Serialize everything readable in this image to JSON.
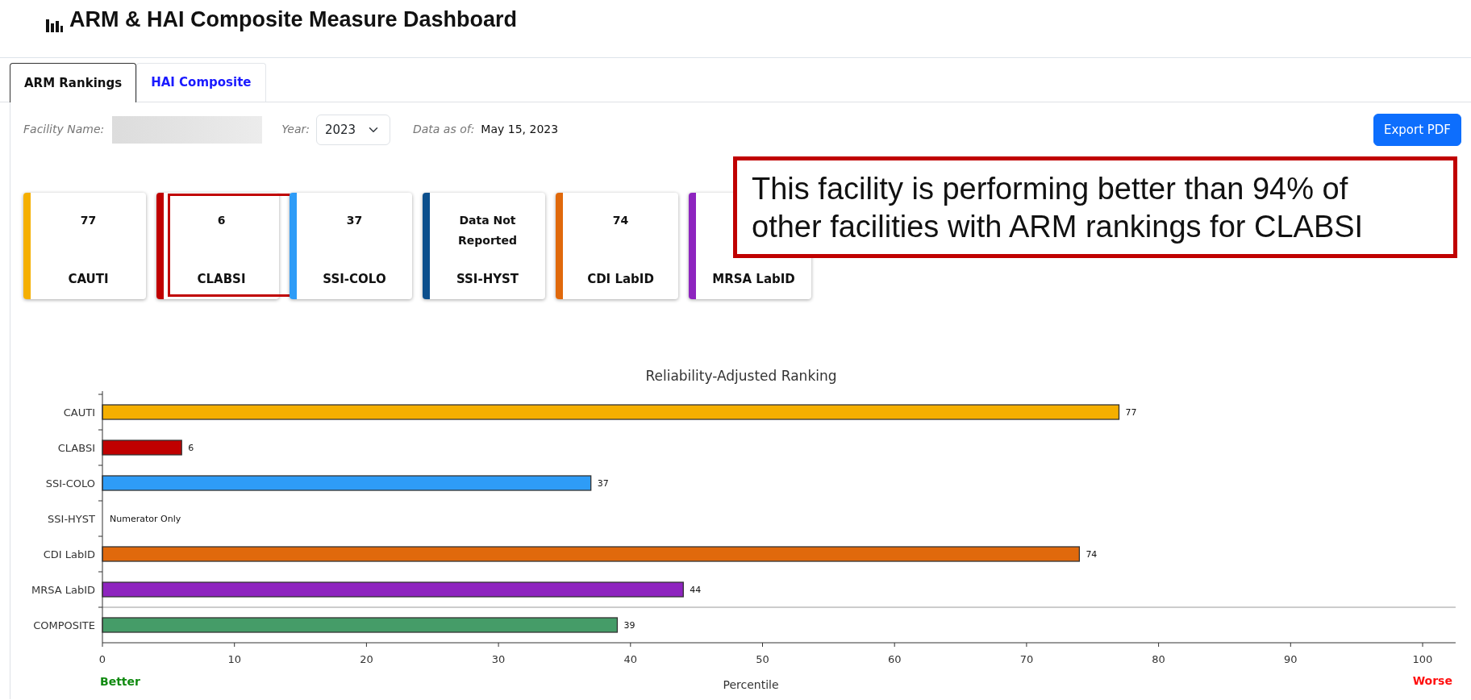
{
  "title": "ARM & HAI Composite Measure Dashboard",
  "tabs": [
    {
      "label": "ARM Rankings",
      "selected": true
    },
    {
      "label": "HAI Composite",
      "selected": false
    }
  ],
  "filters": {
    "facility_label": "Facility Name:",
    "facility_redacted": true,
    "year_label": "Year:",
    "year_value": "2023",
    "data_as_of_label": "Data as of:",
    "data_as_of": "May 15, 2023"
  },
  "export_button": "Export PDF",
  "cards": [
    {
      "value": "77",
      "label": "CAUTI",
      "color": "#f5af00",
      "highlighted": false
    },
    {
      "value": "6",
      "label": "CLABSI",
      "color": "#c00000",
      "highlighted": true
    },
    {
      "value": "37",
      "label": "SSI-COLO",
      "color": "#2e9cf7",
      "highlighted": false
    },
    {
      "value": "Data Not Reported",
      "label": "SSI-HYST",
      "color": "#0c4f8c",
      "highlighted": false
    },
    {
      "value": "74",
      "label": "CDI LabID",
      "color": "#e0690c",
      "highlighted": false
    },
    {
      "label": "MRSA LabID",
      "color": "#8e24bf",
      "highlighted": false
    }
  ],
  "callout": "This facility is performing better than 94% of other facilities with ARM rankings for CLABSI",
  "chart": {
    "better_label": "Better",
    "worse_label": "Worse",
    "chart_data": {
      "type": "bar",
      "orientation": "horizontal",
      "title": "Reliability-Adjusted Ranking",
      "xlabel": "Percentile",
      "categories": [
        "CAUTI",
        "CLABSI",
        "SSI-COLO",
        "SSI-HYST",
        "CDI LabID",
        "MRSA LabID",
        "COMPOSITE"
      ],
      "series": [
        {
          "values": [
            77,
            6,
            37,
            null,
            74,
            44,
            39
          ]
        }
      ],
      "colors": [
        "#f5af00",
        "#c00000",
        "#2e9cf7",
        null,
        "#e0690c",
        "#8e24bf",
        "#459c68"
      ],
      "value_labels": [
        "77",
        "6",
        "37",
        null,
        "74",
        "44",
        "39"
      ],
      "xlim": [
        0,
        102.5
      ],
      "xticks": [
        0,
        10,
        20,
        30,
        40,
        50,
        60,
        70,
        80,
        90,
        100
      ],
      "annotations": [
        "Numerator Only"
      ]
    }
  }
}
